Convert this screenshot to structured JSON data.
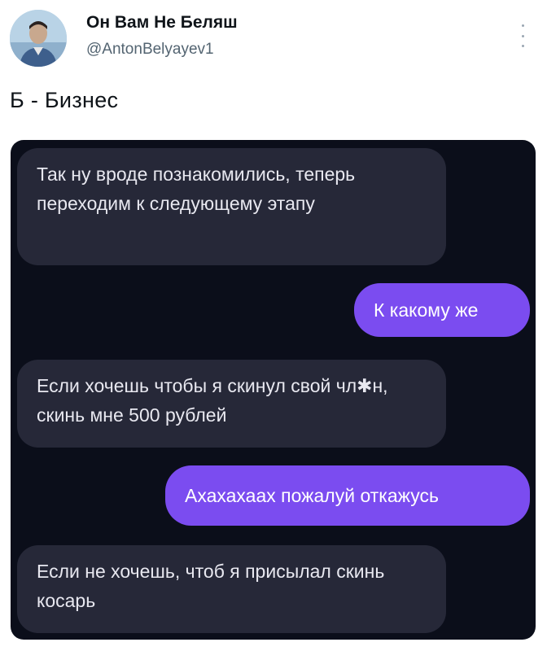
{
  "post": {
    "author_name": "Он Вам Не Беляш",
    "author_handle": "@AntonBelyayev1",
    "text": "Б - Бизнес"
  },
  "chat": {
    "messages": [
      {
        "direction": "incoming",
        "text": "Так ну вроде познакомились, теперь переходим к следующему этапу"
      },
      {
        "direction": "outgoing",
        "text": "К какому же"
      },
      {
        "direction": "incoming",
        "text": "Если хочешь чтобы я скинул свой чл✱н, скинь мне 500 рублей"
      },
      {
        "direction": "outgoing",
        "text": "Ахахахаах пожалуй откажусь"
      },
      {
        "direction": "incoming",
        "text": "Если не хочешь, чтоб я присылал скинь косарь"
      }
    ],
    "colors": {
      "background": "#0b0e1a",
      "incoming_bubble": "#262838",
      "outgoing_bubble": "#7b4cf0"
    }
  },
  "icons": {
    "more": "more-vertical-icon",
    "avatar": "user-avatar"
  }
}
